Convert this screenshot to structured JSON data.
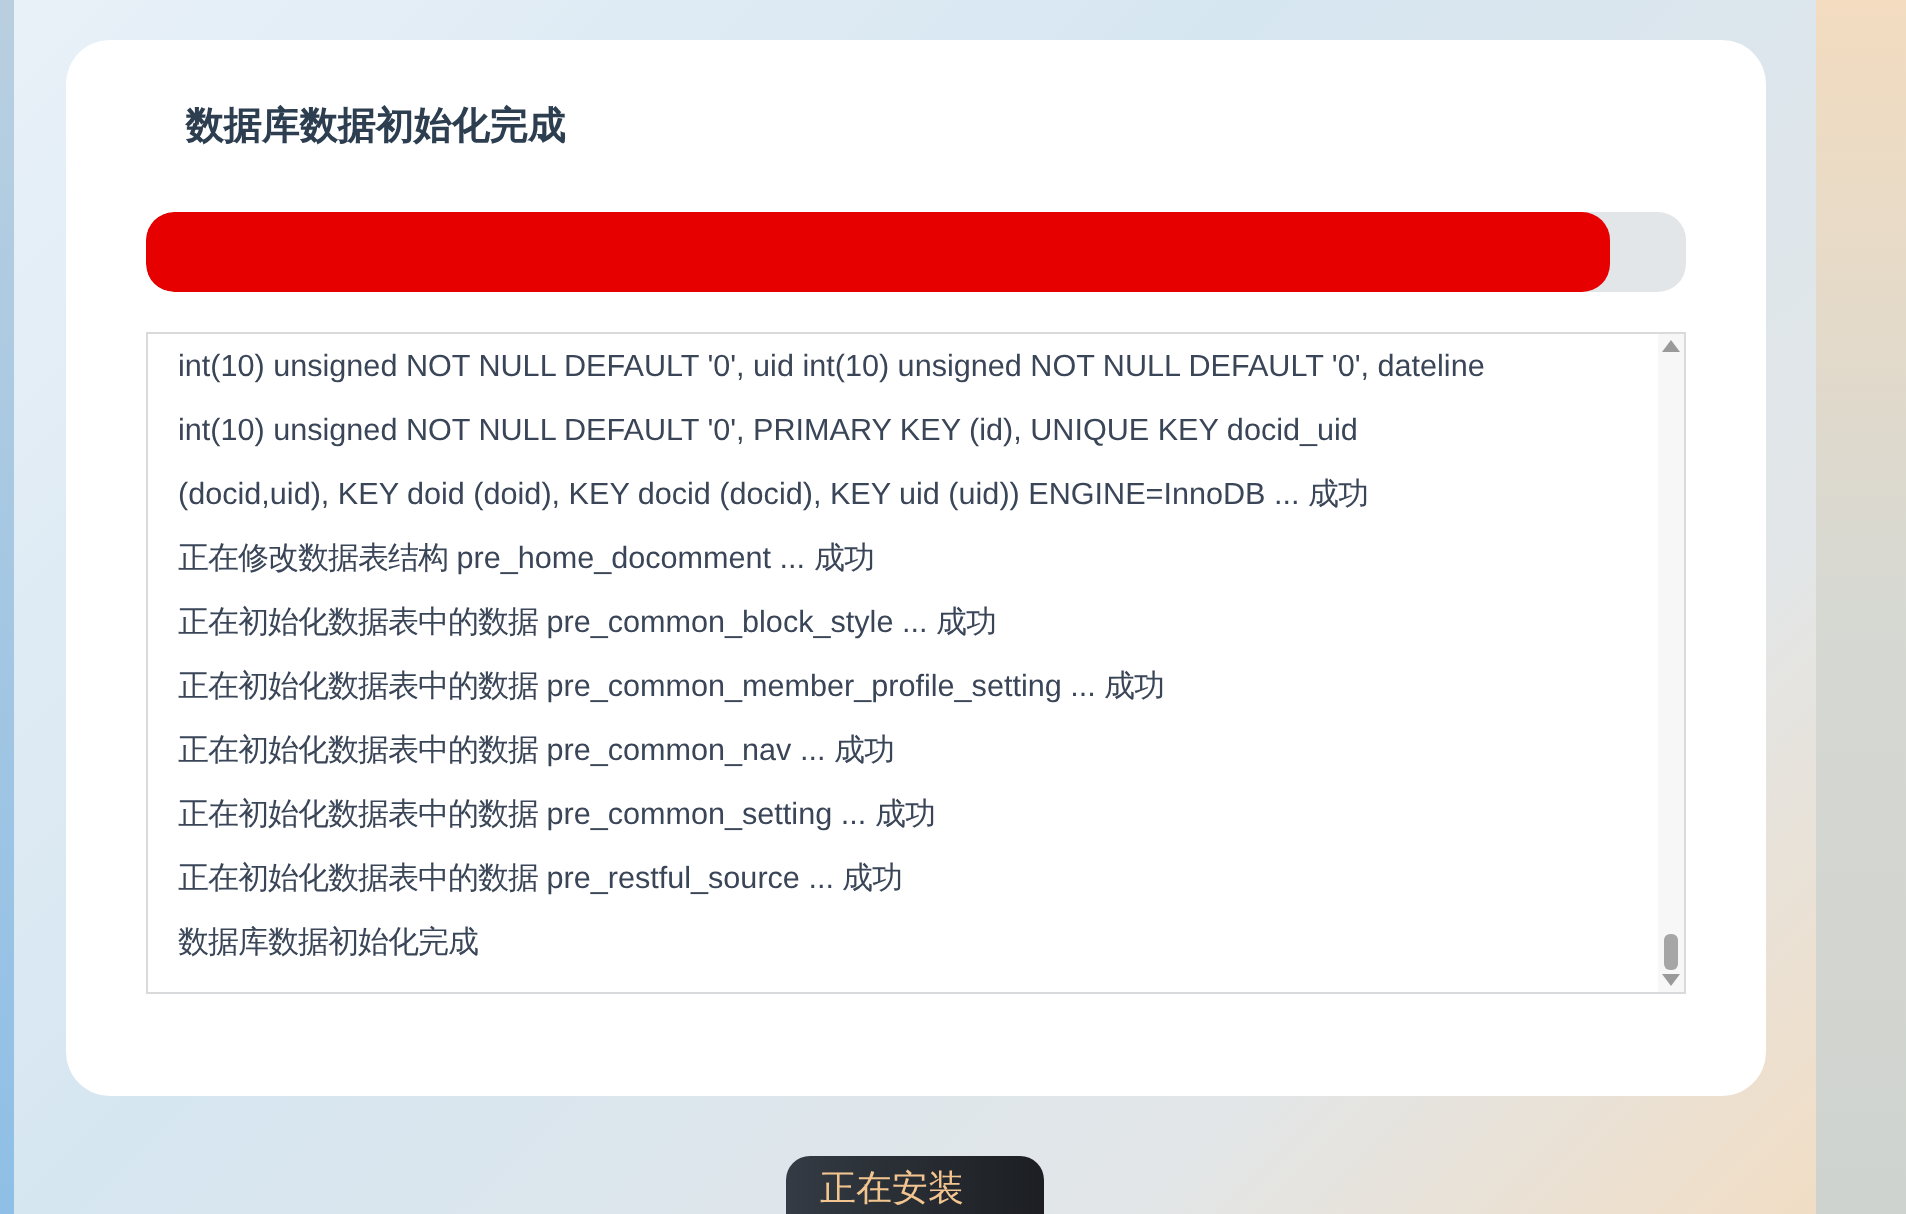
{
  "title": "数据库数据初始化完成",
  "progress": {
    "level": 0.95
  },
  "log": [
    "int(10) unsigned NOT NULL DEFAULT '0', uid int(10) unsigned NOT NULL DEFAULT '0', dateline",
    "int(10) unsigned NOT NULL DEFAULT '0', PRIMARY KEY (id), UNIQUE KEY docid_uid",
    "(docid,uid), KEY doid (doid), KEY docid (docid), KEY uid (uid)) ENGINE=InnoDB ... 成功",
    "正在修改数据表结构 pre_home_docomment ... 成功",
    "正在初始化数据表中的数据 pre_common_block_style ... 成功",
    "正在初始化数据表中的数据 pre_common_member_profile_setting ... 成功",
    "正在初始化数据表中的数据 pre_common_nav ... 成功",
    "正在初始化数据表中的数据 pre_common_setting ... 成功",
    "正在初始化数据表中的数据 pre_restful_source ... 成功",
    "数据库数据初始化完成"
  ],
  "button": {
    "label": "正在安装"
  }
}
